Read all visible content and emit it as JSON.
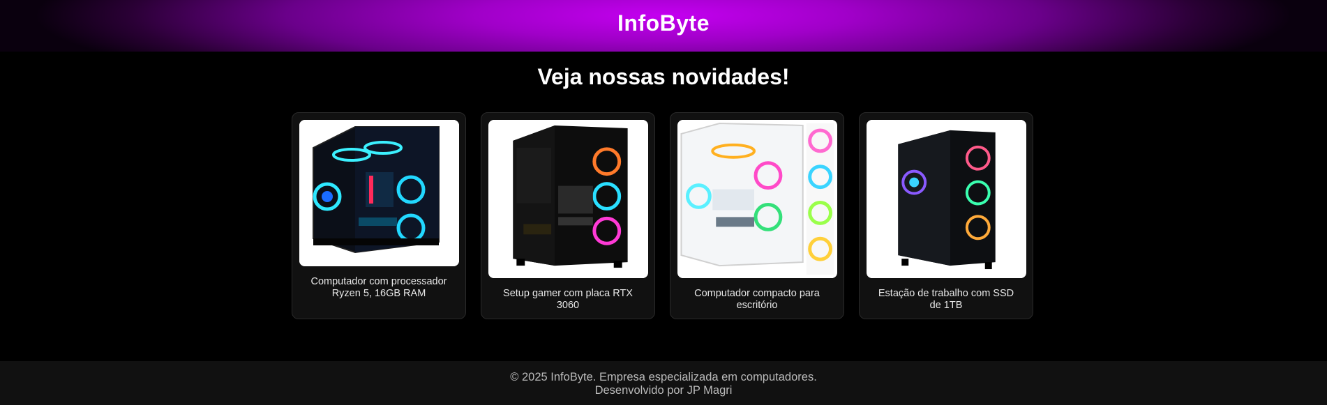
{
  "header": {
    "brand": "InfoByte"
  },
  "main": {
    "title": "Veja nossas novidades!",
    "products": [
      {
        "image_icon": "pc-case-icon",
        "caption": "Computador com processador Ryzen 5, 16GB RAM"
      },
      {
        "image_icon": "pc-case-icon",
        "caption": "Setup gamer com placa RTX 3060"
      },
      {
        "image_icon": "pc-case-icon",
        "caption": "Computador compacto para escritório"
      },
      {
        "image_icon": "pc-case-icon",
        "caption": "Estação de trabalho com SSD de 1TB"
      }
    ]
  },
  "footer": {
    "line1": "© 2025 InfoByte. Empresa especializada em computadores.",
    "line2": "Desenvolvido por JP Magri"
  },
  "colors": {
    "header_accent": "#c400f0",
    "background": "#000000",
    "card_background": "#111111"
  }
}
